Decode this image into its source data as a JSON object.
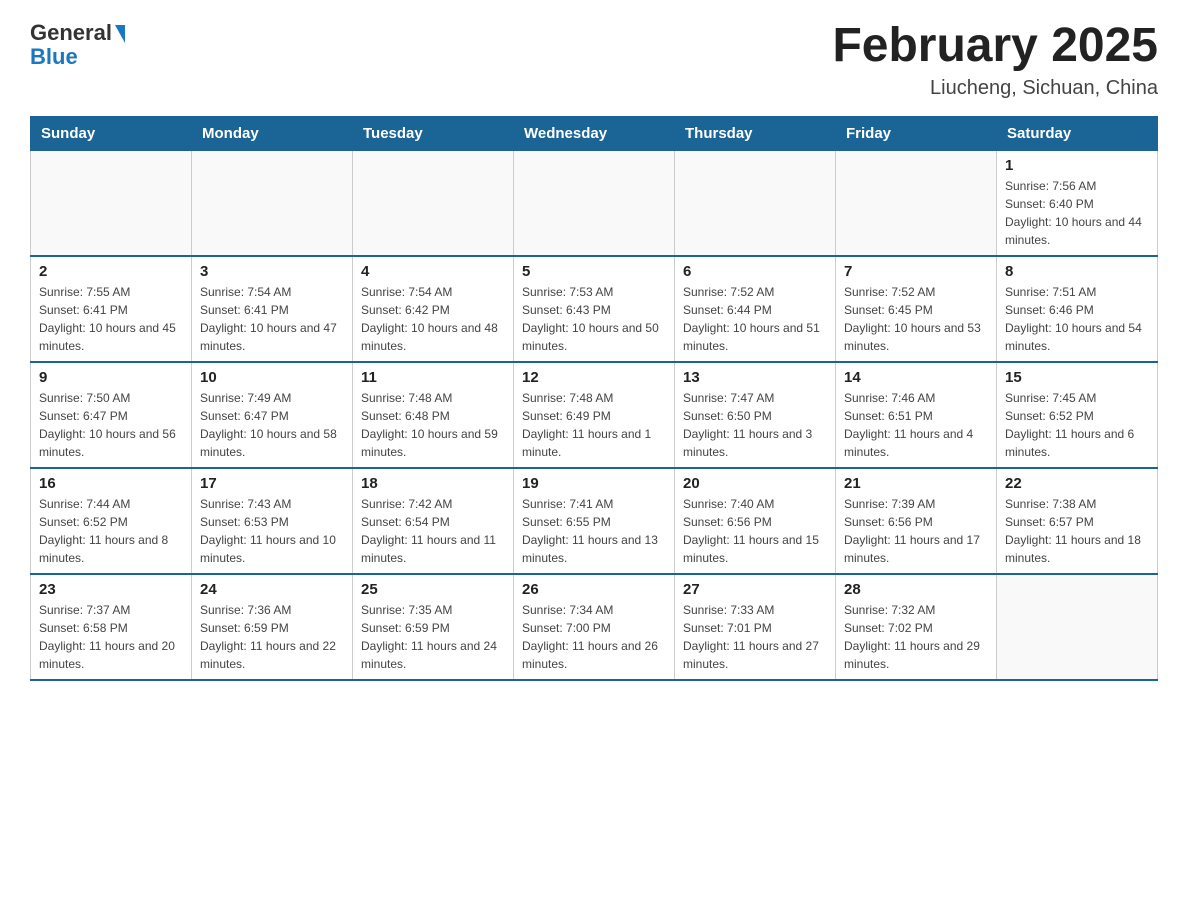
{
  "logo": {
    "general": "General",
    "blue": "Blue"
  },
  "title": "February 2025",
  "subtitle": "Liucheng, Sichuan, China",
  "days_of_week": [
    "Sunday",
    "Monday",
    "Tuesday",
    "Wednesday",
    "Thursday",
    "Friday",
    "Saturday"
  ],
  "weeks": [
    [
      {
        "day": "",
        "info": ""
      },
      {
        "day": "",
        "info": ""
      },
      {
        "day": "",
        "info": ""
      },
      {
        "day": "",
        "info": ""
      },
      {
        "day": "",
        "info": ""
      },
      {
        "day": "",
        "info": ""
      },
      {
        "day": "1",
        "info": "Sunrise: 7:56 AM\nSunset: 6:40 PM\nDaylight: 10 hours and 44 minutes."
      }
    ],
    [
      {
        "day": "2",
        "info": "Sunrise: 7:55 AM\nSunset: 6:41 PM\nDaylight: 10 hours and 45 minutes."
      },
      {
        "day": "3",
        "info": "Sunrise: 7:54 AM\nSunset: 6:41 PM\nDaylight: 10 hours and 47 minutes."
      },
      {
        "day": "4",
        "info": "Sunrise: 7:54 AM\nSunset: 6:42 PM\nDaylight: 10 hours and 48 minutes."
      },
      {
        "day": "5",
        "info": "Sunrise: 7:53 AM\nSunset: 6:43 PM\nDaylight: 10 hours and 50 minutes."
      },
      {
        "day": "6",
        "info": "Sunrise: 7:52 AM\nSunset: 6:44 PM\nDaylight: 10 hours and 51 minutes."
      },
      {
        "day": "7",
        "info": "Sunrise: 7:52 AM\nSunset: 6:45 PM\nDaylight: 10 hours and 53 minutes."
      },
      {
        "day": "8",
        "info": "Sunrise: 7:51 AM\nSunset: 6:46 PM\nDaylight: 10 hours and 54 minutes."
      }
    ],
    [
      {
        "day": "9",
        "info": "Sunrise: 7:50 AM\nSunset: 6:47 PM\nDaylight: 10 hours and 56 minutes."
      },
      {
        "day": "10",
        "info": "Sunrise: 7:49 AM\nSunset: 6:47 PM\nDaylight: 10 hours and 58 minutes."
      },
      {
        "day": "11",
        "info": "Sunrise: 7:48 AM\nSunset: 6:48 PM\nDaylight: 10 hours and 59 minutes."
      },
      {
        "day": "12",
        "info": "Sunrise: 7:48 AM\nSunset: 6:49 PM\nDaylight: 11 hours and 1 minute."
      },
      {
        "day": "13",
        "info": "Sunrise: 7:47 AM\nSunset: 6:50 PM\nDaylight: 11 hours and 3 minutes."
      },
      {
        "day": "14",
        "info": "Sunrise: 7:46 AM\nSunset: 6:51 PM\nDaylight: 11 hours and 4 minutes."
      },
      {
        "day": "15",
        "info": "Sunrise: 7:45 AM\nSunset: 6:52 PM\nDaylight: 11 hours and 6 minutes."
      }
    ],
    [
      {
        "day": "16",
        "info": "Sunrise: 7:44 AM\nSunset: 6:52 PM\nDaylight: 11 hours and 8 minutes."
      },
      {
        "day": "17",
        "info": "Sunrise: 7:43 AM\nSunset: 6:53 PM\nDaylight: 11 hours and 10 minutes."
      },
      {
        "day": "18",
        "info": "Sunrise: 7:42 AM\nSunset: 6:54 PM\nDaylight: 11 hours and 11 minutes."
      },
      {
        "day": "19",
        "info": "Sunrise: 7:41 AM\nSunset: 6:55 PM\nDaylight: 11 hours and 13 minutes."
      },
      {
        "day": "20",
        "info": "Sunrise: 7:40 AM\nSunset: 6:56 PM\nDaylight: 11 hours and 15 minutes."
      },
      {
        "day": "21",
        "info": "Sunrise: 7:39 AM\nSunset: 6:56 PM\nDaylight: 11 hours and 17 minutes."
      },
      {
        "day": "22",
        "info": "Sunrise: 7:38 AM\nSunset: 6:57 PM\nDaylight: 11 hours and 18 minutes."
      }
    ],
    [
      {
        "day": "23",
        "info": "Sunrise: 7:37 AM\nSunset: 6:58 PM\nDaylight: 11 hours and 20 minutes."
      },
      {
        "day": "24",
        "info": "Sunrise: 7:36 AM\nSunset: 6:59 PM\nDaylight: 11 hours and 22 minutes."
      },
      {
        "day": "25",
        "info": "Sunrise: 7:35 AM\nSunset: 6:59 PM\nDaylight: 11 hours and 24 minutes."
      },
      {
        "day": "26",
        "info": "Sunrise: 7:34 AM\nSunset: 7:00 PM\nDaylight: 11 hours and 26 minutes."
      },
      {
        "day": "27",
        "info": "Sunrise: 7:33 AM\nSunset: 7:01 PM\nDaylight: 11 hours and 27 minutes."
      },
      {
        "day": "28",
        "info": "Sunrise: 7:32 AM\nSunset: 7:02 PM\nDaylight: 11 hours and 29 minutes."
      },
      {
        "day": "",
        "info": ""
      }
    ]
  ]
}
